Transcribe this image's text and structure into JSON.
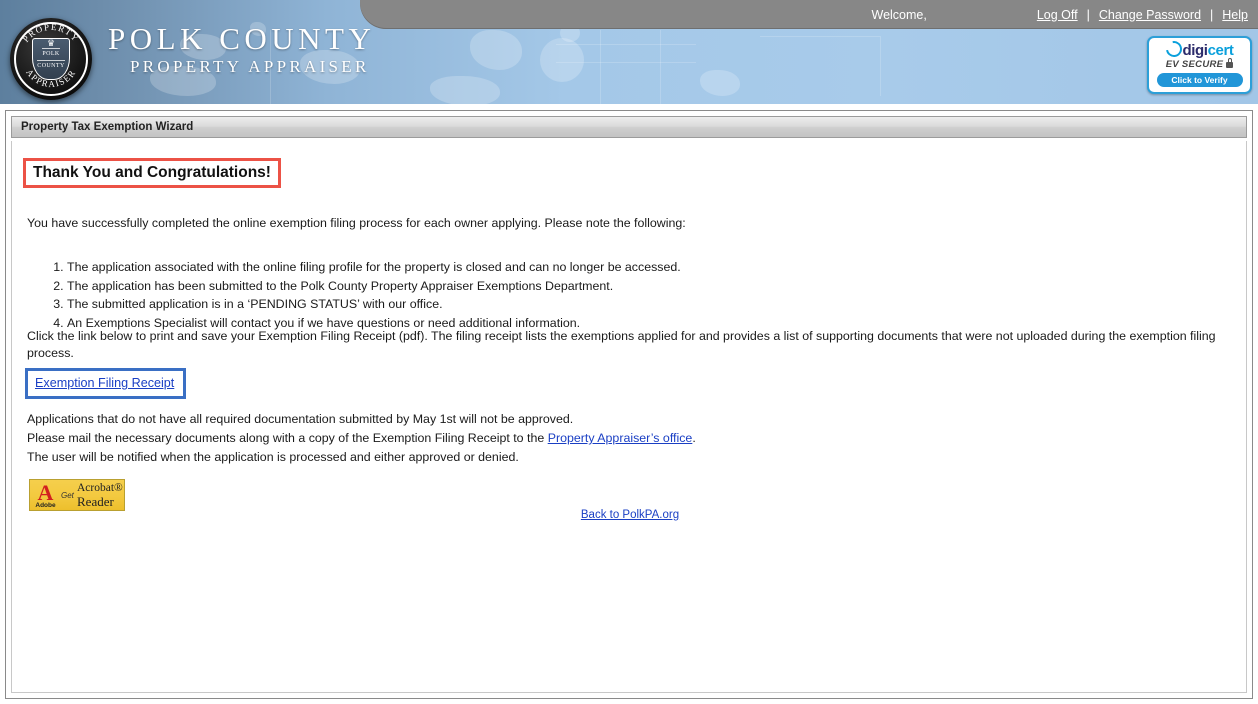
{
  "header": {
    "welcome": "Welcome,",
    "links": [
      {
        "label": "Log Off"
      },
      {
        "label": "Change Password"
      },
      {
        "label": "Help"
      }
    ],
    "separator": "|",
    "brand": {
      "title": "POLK COUNTY",
      "subtitle": "PROPERTY APPRAISER",
      "seal": {
        "arc_top": "PROPERTY",
        "arc_bottom": "APPRAISER",
        "shield_line1": "POLK",
        "shield_line2": "COUNTY",
        "crown": "♛"
      }
    },
    "digicert": {
      "logo_prefix": "digi",
      "logo_suffix": "cert",
      "tagline": "EV SECURE",
      "button": "Click to Verify"
    }
  },
  "panel": {
    "title": "Property Tax Exemption Wizard",
    "heading": "Thank You and Congratulations!",
    "intro": "You have successfully completed the online exemption filing process for each owner applying. Please note the following:",
    "notes": [
      "The application associated with the online filing profile for the property is closed and can no longer be accessed.",
      "The application has been submitted to the Polk County Property Appraiser Exemptions Department.",
      "The submitted application is in a ‘PENDING STATUS’ with our office.",
      "An Exemptions Specialist will contact you if we have questions or need additional information."
    ],
    "receipt_paragraph": "Click the link below to print and save your Exemption Filing Receipt (pdf). The filing receipt lists the exemptions applied for and provides a list of supporting documents that were not uploaded during the exemption filing process.",
    "receipt_link": "Exemption Filing Receipt",
    "closing": {
      "line1": "Applications that do not have all required documentation submitted by May 1st will not be approved.",
      "line2_before": "Please mail the necessary documents along with a copy of the Exemption Filing Receipt to the ",
      "line2_link": "Property Appraiser’s office",
      "line2_after": ".",
      "line3": "The user will be notified when the application is processed and either approved or denied."
    },
    "acrobat_badge": {
      "letter": "A",
      "adobe": "Adobe",
      "get": "Get",
      "acrobat": "Acrobat®",
      "reader": "Reader"
    },
    "back_link": "Back to PolkPA.org"
  },
  "colors": {
    "annotation_red": "#ec5246",
    "annotation_blue": "#3a6fc4",
    "link_blue": "#1a3fc4",
    "header_blue": "#a4c8e8",
    "topbar_gray": "#878787"
  }
}
